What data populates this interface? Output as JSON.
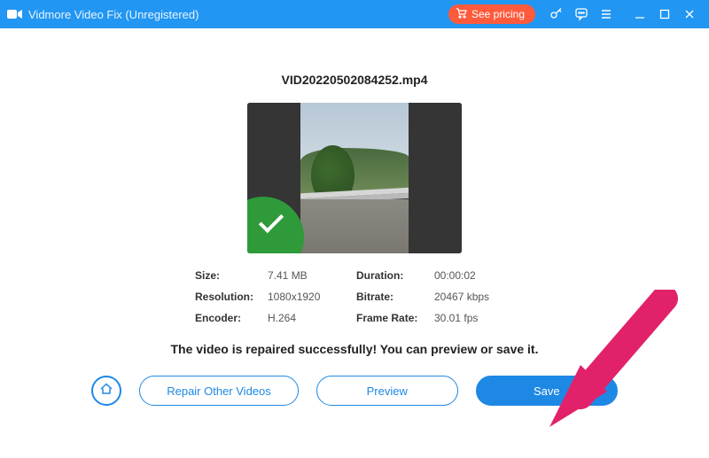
{
  "titlebar": {
    "app_title": "Vidmore Video Fix (Unregistered)",
    "pricing_label": "See pricing"
  },
  "main": {
    "filename": "VID20220502084252.mp4",
    "info": {
      "size_label": "Size:",
      "size_value": "7.41 MB",
      "duration_label": "Duration:",
      "duration_value": "00:00:02",
      "resolution_label": "Resolution:",
      "resolution_value": "1080x1920",
      "bitrate_label": "Bitrate:",
      "bitrate_value": "20467 kbps",
      "encoder_label": "Encoder:",
      "encoder_value": "H.264",
      "framerate_label": "Frame Rate:",
      "framerate_value": "30.01 fps"
    },
    "success_message": "The video is repaired successfully! You can preview or save it.",
    "buttons": {
      "repair_other": "Repair Other Videos",
      "preview": "Preview",
      "save": "Save"
    }
  }
}
